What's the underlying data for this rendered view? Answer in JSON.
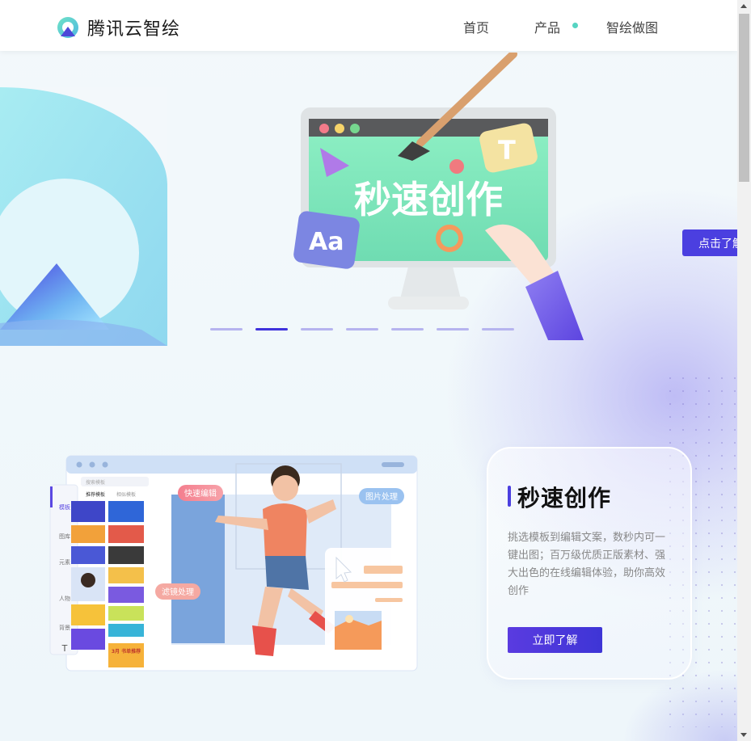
{
  "header": {
    "brand": "腾讯云智绘",
    "nav": [
      {
        "label": "首页"
      },
      {
        "label": "产品"
      },
      {
        "label": "智绘做图"
      }
    ]
  },
  "hero": {
    "monitor_text": "秒速创作",
    "badge_text": "Aa",
    "tile_text": "T",
    "cta_label": "点击了解",
    "slides_total": 7,
    "active_slide": 2
  },
  "feature": {
    "title": "秒速创作",
    "description": "挑选模板到编辑文案，数秒内可一键出图；百万级优质正版素材、强大出色的在线编辑体验，助你高效创作",
    "button_label": "立即了解",
    "editor": {
      "tags": [
        "快速编辑",
        "图片处理",
        "滤镜处理"
      ],
      "sidebar": [
        "模板",
        "图库",
        "元素",
        "人物",
        "背景",
        "T"
      ],
      "panel_tabs": [
        "推荐模板",
        "相似模板"
      ],
      "poster_text": "3月\n书单推荐",
      "search_placeholder": "搜索模板"
    }
  },
  "colors": {
    "accent": "#4b3fe0",
    "brand_teal": "#56d4c2"
  }
}
